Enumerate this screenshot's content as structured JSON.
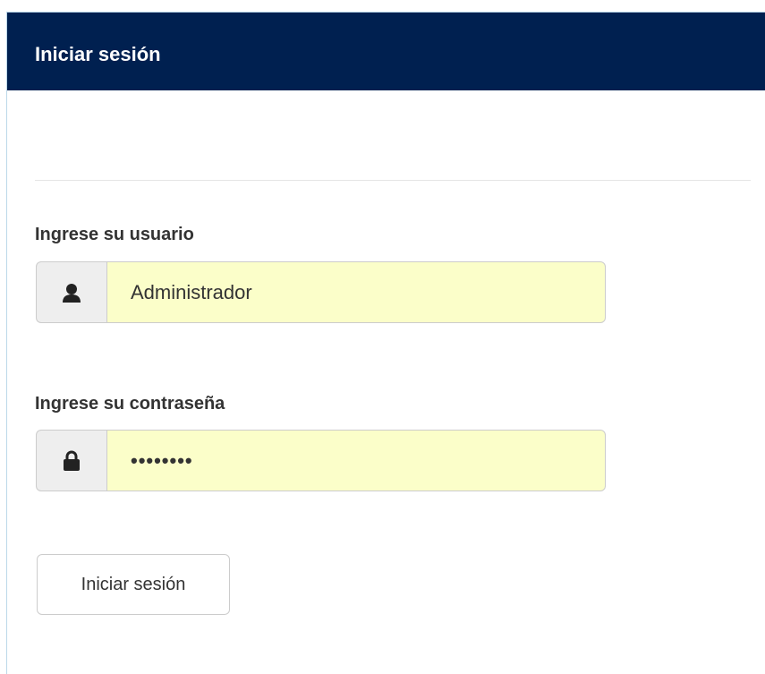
{
  "panel": {
    "title": "Iniciar sesión"
  },
  "form": {
    "username": {
      "label": "Ingrese su usuario",
      "value": "Administrador",
      "icon": "user-icon"
    },
    "password": {
      "label": "Ingrese su contraseña",
      "value": "12345678",
      "icon": "lock-icon"
    },
    "submit_label": "Iniciar sesión"
  },
  "colors": {
    "header_bg": "#002050",
    "autofill_bg": "#fbfec9",
    "addon_bg": "#eeeeee"
  }
}
